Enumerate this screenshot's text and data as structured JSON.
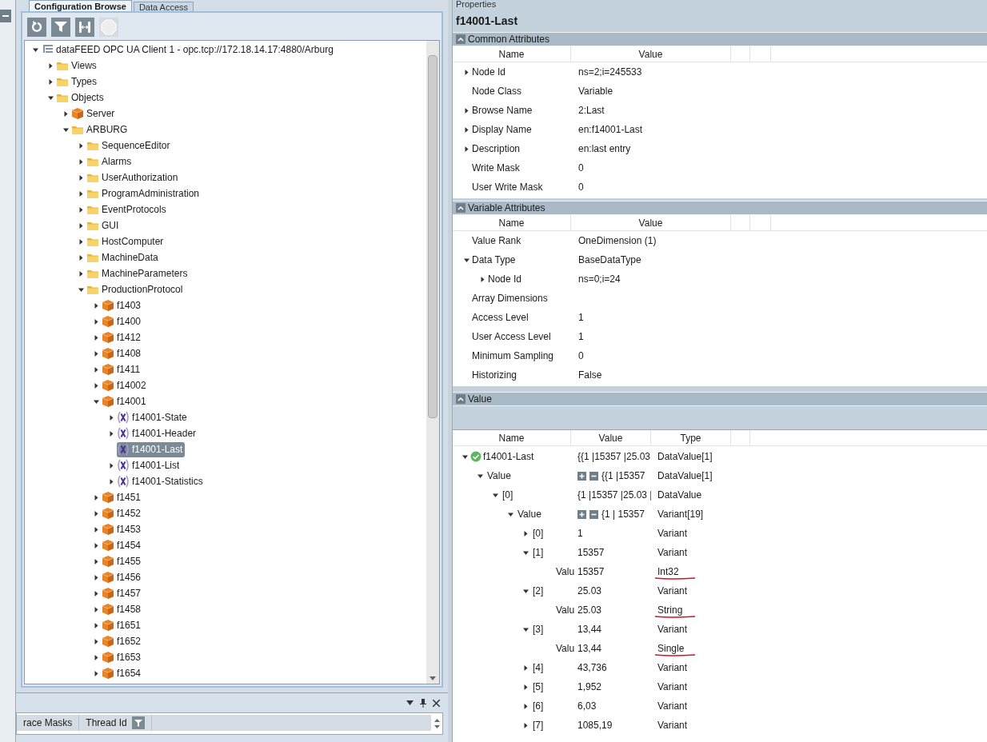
{
  "left_panel": {
    "tabs": [
      {
        "label": "Configuration Browse",
        "selected": true
      },
      {
        "label": "Data Access",
        "selected": false
      }
    ],
    "toolbar": [
      {
        "kind": "refresh",
        "disabled": false
      },
      {
        "kind": "filter",
        "disabled": false
      },
      {
        "kind": "connect",
        "disabled": false
      },
      {
        "kind": "stop",
        "disabled": true
      }
    ],
    "tree": [
      {
        "label": "dataFEED OPC UA Client 1 - opc.tcp://172.18.14.17:4880/Arburg",
        "kind": "client",
        "expandable": true,
        "expanded": true,
        "selected": false,
        "children": [
          {
            "label": "Views",
            "kind": "folder",
            "expandable": true,
            "expanded": false,
            "selected": false
          },
          {
            "label": "Types",
            "kind": "folder",
            "expandable": true,
            "expanded": false,
            "selected": false
          },
          {
            "label": "Objects",
            "kind": "folder",
            "expandable": true,
            "expanded": true,
            "selected": false,
            "children": [
              {
                "label": "Server",
                "kind": "object",
                "expandable": true,
                "expanded": false,
                "selected": false
              },
              {
                "label": "ARBURG",
                "kind": "folder",
                "expandable": true,
                "expanded": true,
                "selected": false,
                "children": [
                  {
                    "label": "SequenceEditor",
                    "kind": "folder",
                    "expandable": true,
                    "expanded": false,
                    "selected": false
                  },
                  {
                    "label": "Alarms",
                    "kind": "folder",
                    "expandable": true,
                    "expanded": false,
                    "selected": false
                  },
                  {
                    "label": "UserAuthorization",
                    "kind": "folder",
                    "expandable": true,
                    "expanded": false,
                    "selected": false
                  },
                  {
                    "label": "ProgramAdministration",
                    "kind": "folder",
                    "expandable": true,
                    "expanded": false,
                    "selected": false
                  },
                  {
                    "label": "EventProtocols",
                    "kind": "folder",
                    "expandable": true,
                    "expanded": false,
                    "selected": false
                  },
                  {
                    "label": "GUI",
                    "kind": "folder",
                    "expandable": true,
                    "expanded": false,
                    "selected": false
                  },
                  {
                    "label": "HostComputer",
                    "kind": "folder",
                    "expandable": true,
                    "expanded": false,
                    "selected": false
                  },
                  {
                    "label": "MachineData",
                    "kind": "folder",
                    "expandable": true,
                    "expanded": false,
                    "selected": false
                  },
                  {
                    "label": "MachineParameters",
                    "kind": "folder",
                    "expandable": true,
                    "expanded": false,
                    "selected": false
                  },
                  {
                    "label": "ProductionProtocol",
                    "kind": "folder",
                    "expandable": true,
                    "expanded": true,
                    "selected": false,
                    "children": [
                      {
                        "label": "f1403",
                        "kind": "object",
                        "expandable": true,
                        "expanded": false,
                        "selected": false
                      },
                      {
                        "label": "f1400",
                        "kind": "object",
                        "expandable": true,
                        "expanded": false,
                        "selected": false
                      },
                      {
                        "label": "f1412",
                        "kind": "object",
                        "expandable": true,
                        "expanded": false,
                        "selected": false
                      },
                      {
                        "label": "f1408",
                        "kind": "object",
                        "expandable": true,
                        "expanded": false,
                        "selected": false
                      },
                      {
                        "label": "f1411",
                        "kind": "object",
                        "expandable": true,
                        "expanded": false,
                        "selected": false
                      },
                      {
                        "label": "f14002",
                        "kind": "object",
                        "expandable": true,
                        "expanded": false,
                        "selected": false
                      },
                      {
                        "label": "f14001",
                        "kind": "object",
                        "expandable": true,
                        "expanded": true,
                        "selected": false,
                        "children": [
                          {
                            "label": "f14001-State",
                            "kind": "variable",
                            "expandable": true,
                            "expanded": false,
                            "selected": false
                          },
                          {
                            "label": "f14001-Header",
                            "kind": "variable",
                            "expandable": true,
                            "expanded": false,
                            "selected": false
                          },
                          {
                            "label": "f14001-Last",
                            "kind": "variable",
                            "expandable": false,
                            "selected": true
                          },
                          {
                            "label": "f14001-List",
                            "kind": "variable",
                            "expandable": true,
                            "expanded": false,
                            "selected": false
                          },
                          {
                            "label": "f14001-Statistics",
                            "kind": "variable",
                            "expandable": true,
                            "expanded": false,
                            "selected": false
                          }
                        ]
                      },
                      {
                        "label": "f1451",
                        "kind": "object",
                        "expandable": true,
                        "expanded": false,
                        "selected": false
                      },
                      {
                        "label": "f1452",
                        "kind": "object",
                        "expandable": true,
                        "expanded": false,
                        "selected": false
                      },
                      {
                        "label": "f1453",
                        "kind": "object",
                        "expandable": true,
                        "expanded": false,
                        "selected": false
                      },
                      {
                        "label": "f1454",
                        "kind": "object",
                        "expandable": true,
                        "expanded": false,
                        "selected": false
                      },
                      {
                        "label": "f1455",
                        "kind": "object",
                        "expandable": true,
                        "expanded": false,
                        "selected": false
                      },
                      {
                        "label": "f1456",
                        "kind": "object",
                        "expandable": true,
                        "expanded": false,
                        "selected": false
                      },
                      {
                        "label": "f1457",
                        "kind": "object",
                        "expandable": true,
                        "expanded": false,
                        "selected": false
                      },
                      {
                        "label": "f1458",
                        "kind": "object",
                        "expandable": true,
                        "expanded": false,
                        "selected": false
                      },
                      {
                        "label": "f1651",
                        "kind": "object",
                        "expandable": true,
                        "expanded": false,
                        "selected": false
                      },
                      {
                        "label": "f1652",
                        "kind": "object",
                        "expandable": true,
                        "expanded": false,
                        "selected": false
                      },
                      {
                        "label": "f1653",
                        "kind": "object",
                        "expandable": true,
                        "expanded": false,
                        "selected": false
                      },
                      {
                        "label": "f1654",
                        "kind": "object",
                        "expandable": true,
                        "expanded": false,
                        "selected": false
                      }
                    ]
                  }
                ]
              }
            ]
          }
        ]
      }
    ]
  },
  "trace_panel": {
    "columns": [
      {
        "label": "race Masks",
        "filter": false
      },
      {
        "label": "Thread Id",
        "filter": true
      }
    ]
  },
  "properties": {
    "panel_title": "Properties",
    "title": "f14001-Last",
    "sections": [
      {
        "title": "Common Attributes",
        "columns": [
          "Name",
          "Value"
        ],
        "rows": [
          {
            "name": "Node Id",
            "value": "ns=2;i=245533",
            "expandable": true,
            "expanded": false
          },
          {
            "name": "Node Class",
            "value": "Variable",
            "expandable": false
          },
          {
            "name": "Browse Name",
            "value": "2:Last",
            "expandable": true,
            "expanded": false
          },
          {
            "name": "Display Name",
            "value": "en:f14001-Last",
            "expandable": true,
            "expanded": false
          },
          {
            "name": "Description",
            "value": "en:last entry",
            "expandable": true,
            "expanded": false
          },
          {
            "name": "Write Mask",
            "value": "0",
            "expandable": false
          },
          {
            "name": "User Write Mask",
            "value": "0",
            "expandable": false
          }
        ]
      },
      {
        "title": "Variable Attributes",
        "columns": [
          "Name",
          "Value"
        ],
        "rows": [
          {
            "name": "Value Rank",
            "value": "OneDimension (1)",
            "expandable": false
          },
          {
            "name": "Data Type",
            "value": "BaseDataType",
            "expandable": true,
            "expanded": true,
            "children": [
              {
                "name": "Node Id",
                "value": "ns=0;i=24",
                "expandable": true,
                "expanded": false
              }
            ]
          },
          {
            "name": "Array Dimensions",
            "expandable": false
          },
          {
            "name": "Access Level",
            "value": "1",
            "expandable": false
          },
          {
            "name": "User Access Level",
            "value": "1",
            "expandable": false
          },
          {
            "name": "Minimum Sampling",
            "value": "0",
            "expandable": false
          },
          {
            "name": "Historizing",
            "value": "False",
            "expandable": false
          }
        ]
      }
    ],
    "value_section": {
      "title": "Value",
      "columns": [
        "Name",
        "Value",
        "Type"
      ],
      "rows": [
        {
          "name": "f14001-Last",
          "value": "{{1 |15357 |25.03",
          "type": "DataValue[1]",
          "ok": true,
          "expandable": true,
          "expanded": true,
          "array_controls": false,
          "underlined": false,
          "children": [
            {
              "name": "Value",
              "value": "{{1 |15357",
              "type": "DataValue[1]",
              "expandable": true,
              "expanded": true,
              "array_controls": true,
              "underlined": false,
              "children": [
                {
                  "name": "[0]",
                  "value": "{1 |15357 |25.03 |",
                  "type": "DataValue",
                  "expandable": true,
                  "expanded": true,
                  "array_controls": false,
                  "underlined": false,
                  "children": [
                    {
                      "name": "Value",
                      "value": "{1 | 15357",
                      "type": "Variant[19]",
                      "expandable": true,
                      "expanded": true,
                      "array_controls": true,
                      "underlined": false,
                      "children": [
                        {
                          "name": "[0]",
                          "value": "1",
                          "type": "Variant",
                          "expandable": true,
                          "expanded": false,
                          "array_controls": false,
                          "underlined": false
                        },
                        {
                          "name": "[1]",
                          "value": "15357",
                          "type": "Variant",
                          "expandable": true,
                          "expanded": true,
                          "array_controls": false,
                          "underlined": false,
                          "children": [
                            {
                              "name": "Valu",
                              "value": "15357",
                              "type": "Int32",
                              "expandable": false,
                              "array_controls": false,
                              "underlined": true
                            }
                          ]
                        },
                        {
                          "name": "[2]",
                          "value": "25.03",
                          "type": "Variant",
                          "expandable": true,
                          "expanded": true,
                          "array_controls": false,
                          "underlined": false,
                          "children": [
                            {
                              "name": "Valu",
                              "value": "25.03",
                              "type": "String",
                              "expandable": false,
                              "array_controls": false,
                              "underlined": true
                            }
                          ]
                        },
                        {
                          "name": "[3]",
                          "value": "13,44",
                          "type": "Variant",
                          "expandable": true,
                          "expanded": true,
                          "array_controls": false,
                          "underlined": false,
                          "children": [
                            {
                              "name": "Valu",
                              "value": "13,44",
                              "type": "Single",
                              "expandable": false,
                              "array_controls": false,
                              "underlined": true
                            }
                          ]
                        },
                        {
                          "name": "[4]",
                          "value": "43,736",
                          "type": "Variant",
                          "expandable": true,
                          "expanded": false,
                          "array_controls": false,
                          "underlined": false
                        },
                        {
                          "name": "[5]",
                          "value": "1,952",
                          "type": "Variant",
                          "expandable": true,
                          "expanded": false,
                          "array_controls": false,
                          "underlined": false
                        },
                        {
                          "name": "[6]",
                          "value": "6,03",
                          "type": "Variant",
                          "expandable": true,
                          "expanded": false,
                          "array_controls": false,
                          "underlined": false
                        },
                        {
                          "name": "[7]",
                          "value": "1085,19",
                          "type": "Variant",
                          "expandable": true,
                          "expanded": false,
                          "array_controls": false,
                          "underlined": false
                        }
                      ]
                    }
                  ]
                }
              ]
            }
          ]
        }
      ]
    }
  }
}
